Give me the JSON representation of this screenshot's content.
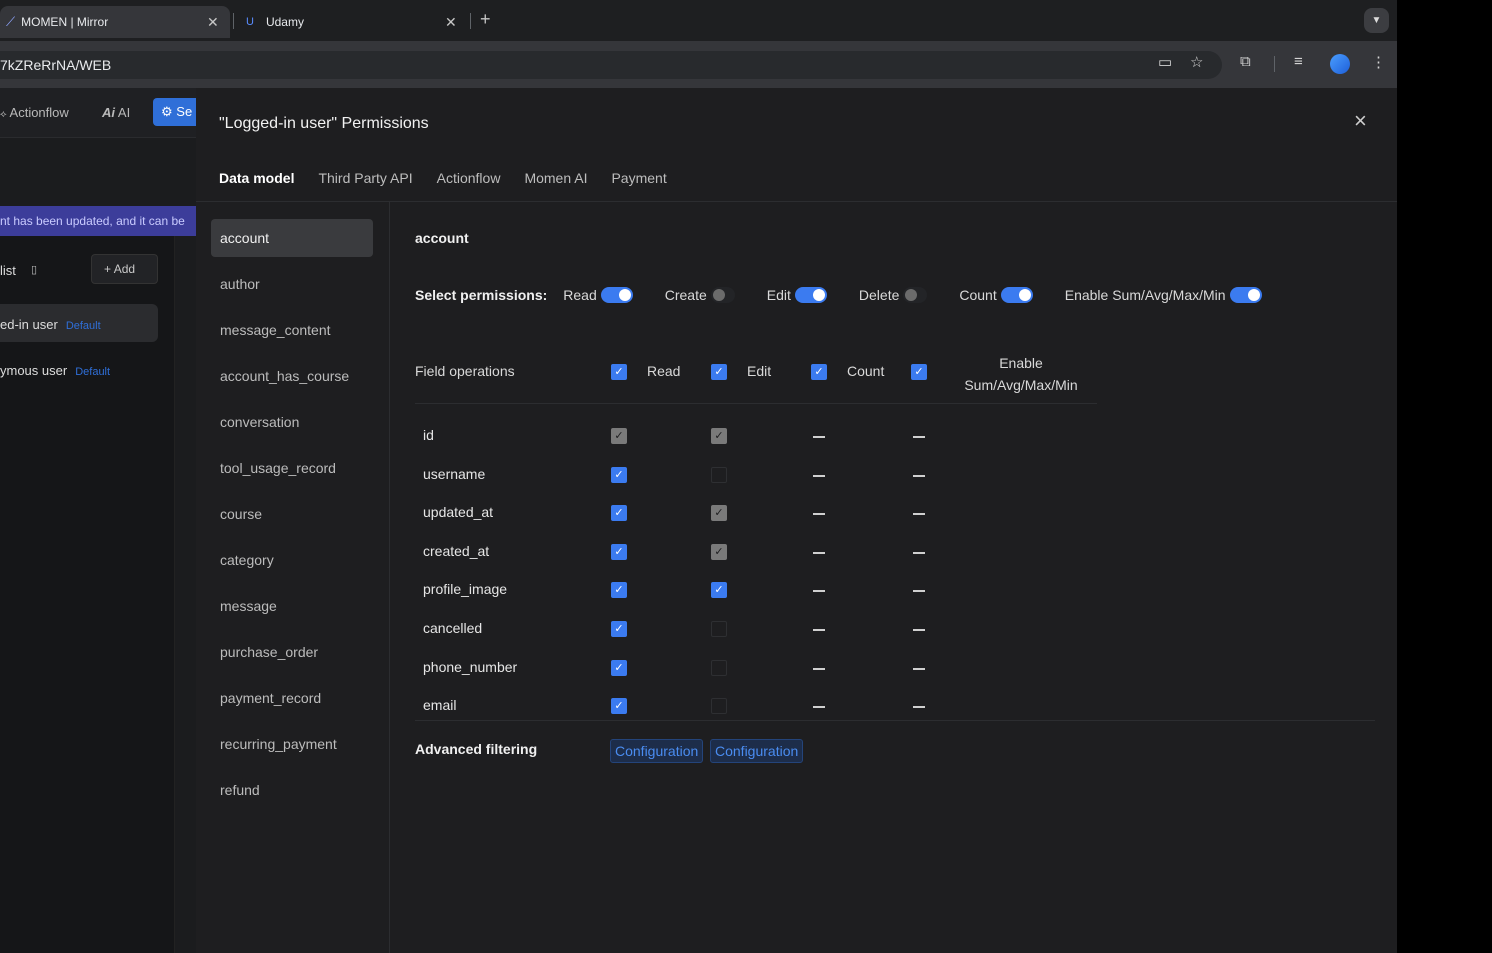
{
  "browser": {
    "tabs": [
      {
        "title": "MOMEN | Mirror",
        "close": "✕"
      },
      {
        "title": "Udamy",
        "close": "✕",
        "favicon": "U"
      }
    ],
    "new_tab": "+",
    "url": "7kZReRrNA/WEB"
  },
  "background_app": {
    "nav": {
      "actionflow": "Actionflow",
      "ai": "AI",
      "settings_partial": "Se"
    },
    "banner": "nt has been updated, and it can be",
    "list_label": "list",
    "add_label": "Add",
    "roles": [
      {
        "name": "ed-in user",
        "badge": "Default"
      },
      {
        "name": "ymous user",
        "badge": "Default"
      }
    ]
  },
  "modal": {
    "title": "\"Logged-in user\" Permissions",
    "tabs": [
      "Data model",
      "Third Party API",
      "Actionflow",
      "Momen AI",
      "Payment"
    ],
    "tables": [
      "account",
      "author",
      "message_content",
      "account_has_course",
      "conversation",
      "tool_usage_record",
      "course",
      "category",
      "message",
      "purchase_order",
      "payment_record",
      "recurring_payment",
      "refund"
    ],
    "selected_table": "account",
    "permissions_label": "Select permissions:",
    "permissions": [
      {
        "label": "Read",
        "on": true
      },
      {
        "label": "Create",
        "on": false
      },
      {
        "label": "Edit",
        "on": true
      },
      {
        "label": "Delete",
        "on": false
      },
      {
        "label": "Count",
        "on": true
      },
      {
        "label": "Enable Sum/Avg/Max/Min",
        "on": true
      }
    ],
    "field_ops_label": "Field operations",
    "columns": {
      "read": "Read",
      "edit": "Edit",
      "count": "Count",
      "enable_line1": "Enable",
      "enable_line2": "Sum/Avg/Max/Min"
    },
    "fields": [
      {
        "name": "id",
        "read": "grey",
        "edit": "grey"
      },
      {
        "name": "username",
        "read": "blue",
        "edit": "empty"
      },
      {
        "name": "updated_at",
        "read": "blue",
        "edit": "grey"
      },
      {
        "name": "created_at",
        "read": "blue",
        "edit": "grey"
      },
      {
        "name": "profile_image",
        "read": "blue",
        "edit": "blue"
      },
      {
        "name": "cancelled",
        "read": "blue",
        "edit": "empty"
      },
      {
        "name": "phone_number",
        "read": "blue",
        "edit": "empty"
      },
      {
        "name": "email",
        "read": "blue",
        "edit": "empty"
      }
    ],
    "advanced_filtering_label": "Advanced filtering",
    "config_buttons": [
      "Configuration",
      "Configuration"
    ]
  },
  "colors": {
    "accent": "#3b7bf0",
    "modal_bg": "#1e1e20",
    "selected_row": "#3a3b3e"
  }
}
